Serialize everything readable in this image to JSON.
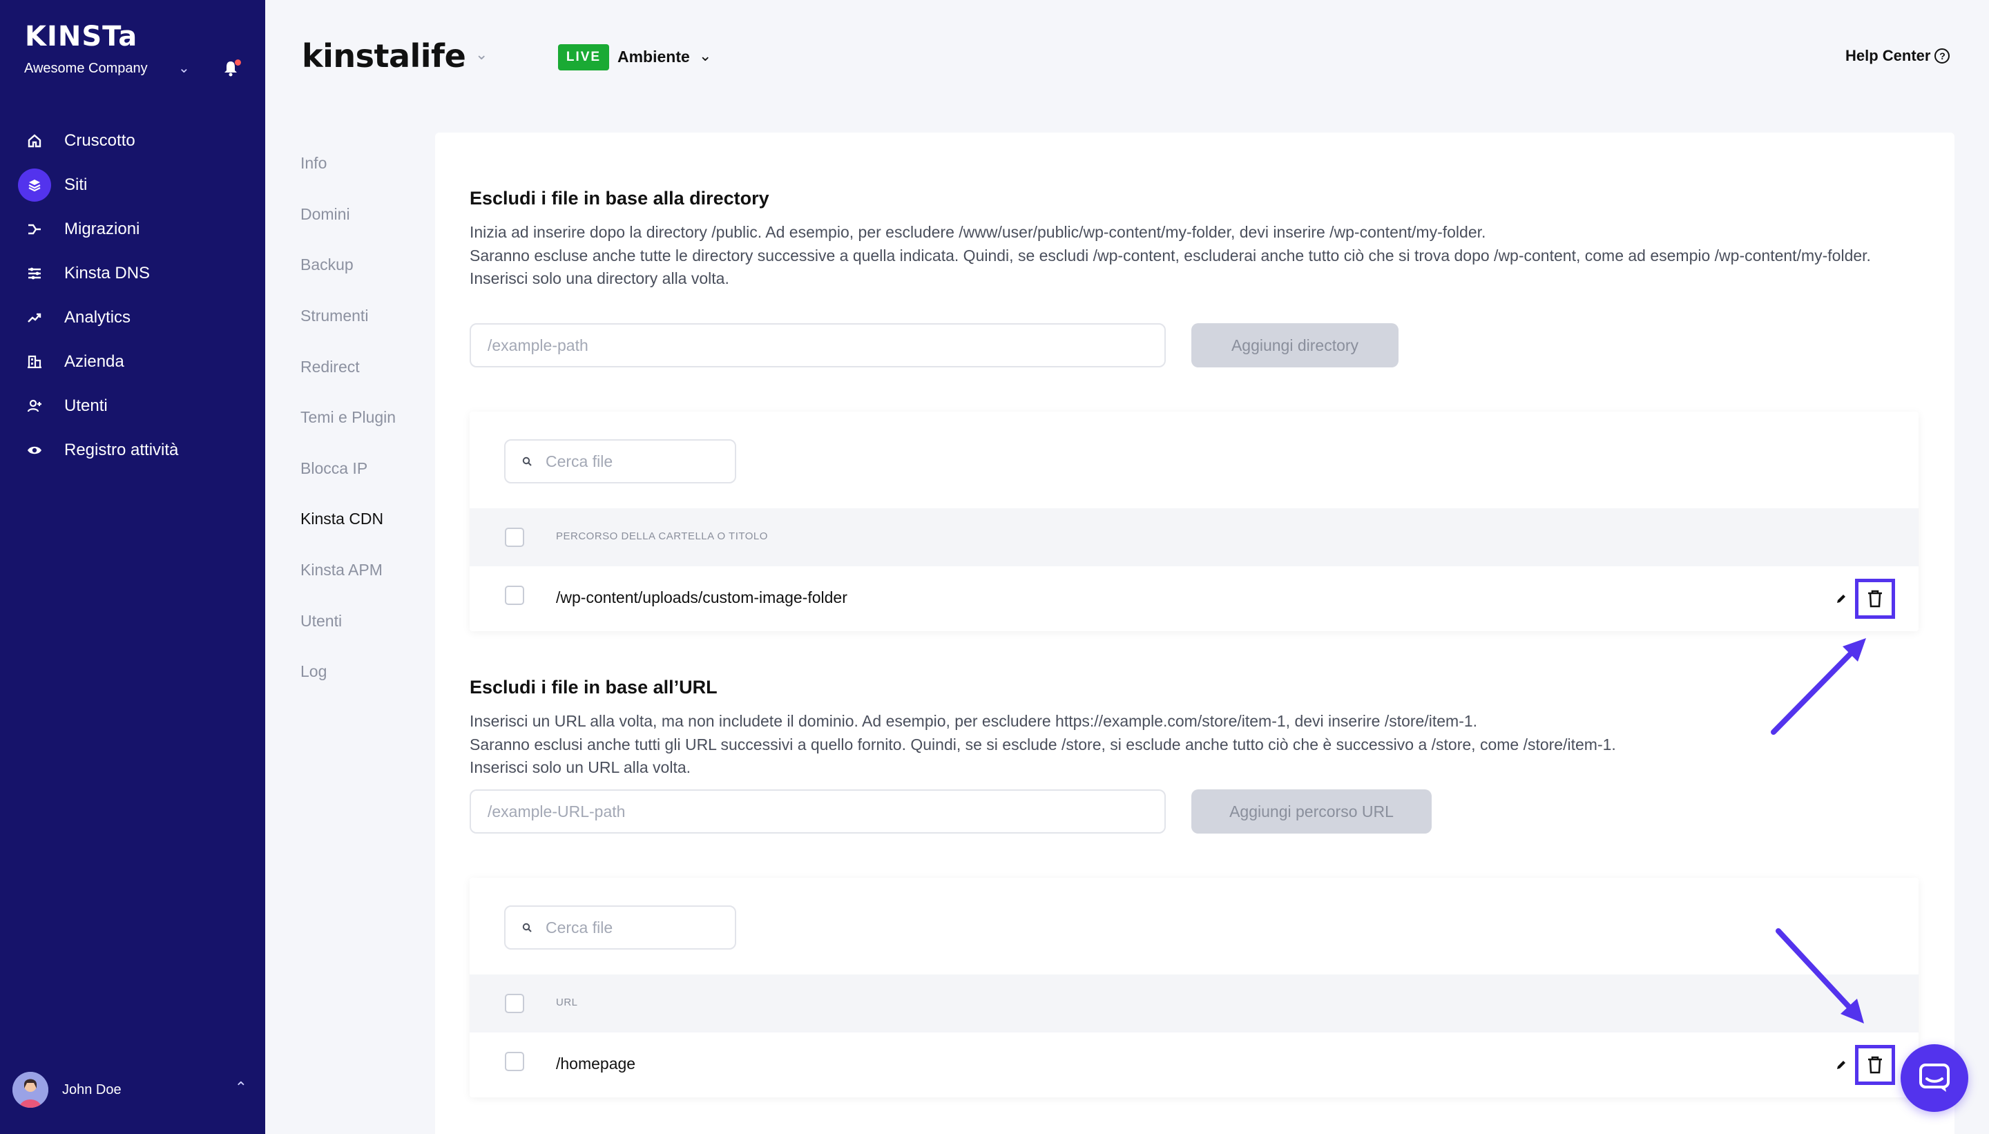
{
  "sidebar": {
    "logo": "KINSTa",
    "company": "Awesome Company",
    "nav": [
      {
        "label": "Cruscotto",
        "icon": "home-icon"
      },
      {
        "label": "Siti",
        "icon": "layers-icon",
        "active": true
      },
      {
        "label": "Migrazioni",
        "icon": "migrate-icon"
      },
      {
        "label": "Kinsta DNS",
        "icon": "dns-icon"
      },
      {
        "label": "Analytics",
        "icon": "trend-icon"
      },
      {
        "label": "Azienda",
        "icon": "building-icon"
      },
      {
        "label": "Utenti",
        "icon": "user-add-icon"
      },
      {
        "label": "Registro attività",
        "icon": "eye-icon"
      }
    ],
    "user": "John Doe"
  },
  "header": {
    "site_title": "kinstalife",
    "live_badge": "LIVE",
    "environment": "Ambiente",
    "help": "Help Center",
    "help_icon": "?"
  },
  "subnav": [
    "Info",
    "Domini",
    "Backup",
    "Strumenti",
    "Redirect",
    "Temi e Plugin",
    "Blocca IP",
    "Kinsta CDN",
    "Kinsta APM",
    "Utenti",
    "Log"
  ],
  "subnav_active": "Kinsta CDN",
  "directory_section": {
    "title": "Escludi i file in base alla directory",
    "desc_1": "Inizia ad inserire dopo la directory /public. Ad esempio, per escludere /www/user/public/wp-content/my-folder, devi inserire /wp-content/my-folder.",
    "desc_2": "Saranno escluse anche tutte le directory successive a quella indicata. Quindi, se escludi /wp-content, escluderai anche tutto ciò che si trova dopo /wp-content, come ad esempio /wp-content/my-folder.",
    "desc_3": "Inserisci solo una directory alla volta.",
    "input_placeholder": "/example-path",
    "button": "Aggiungi directory",
    "search_placeholder": "Cerca file",
    "column": "PERCORSO DELLA CARTELLA O TITOLO",
    "rows": [
      "/wp-content/uploads/custom-image-folder"
    ]
  },
  "url_section": {
    "title": "Escludi i file in base all’URL",
    "desc_1": "Inserisci un URL alla volta, ma non includete il dominio. Ad esempio, per escludere https://example.com/store/item-1, devi inserire /store/item-1.",
    "desc_2": "Saranno esclusi anche tutti gli URL successivi a quello fornito. Quindi, se si esclude /store, si esclude anche tutto ciò che è successivo a /store, come /store/item-1.",
    "desc_3": "Inserisci solo un URL alla volta.",
    "input_placeholder": "/example-URL-path",
    "button": "Aggiungi percorso URL",
    "search_placeholder": "Cerca file",
    "column": "URL",
    "rows": [
      "/homepage"
    ]
  },
  "colors": {
    "sidebar_bg": "#16136a",
    "accent": "#5333ed",
    "live_green": "#1aaa34"
  }
}
